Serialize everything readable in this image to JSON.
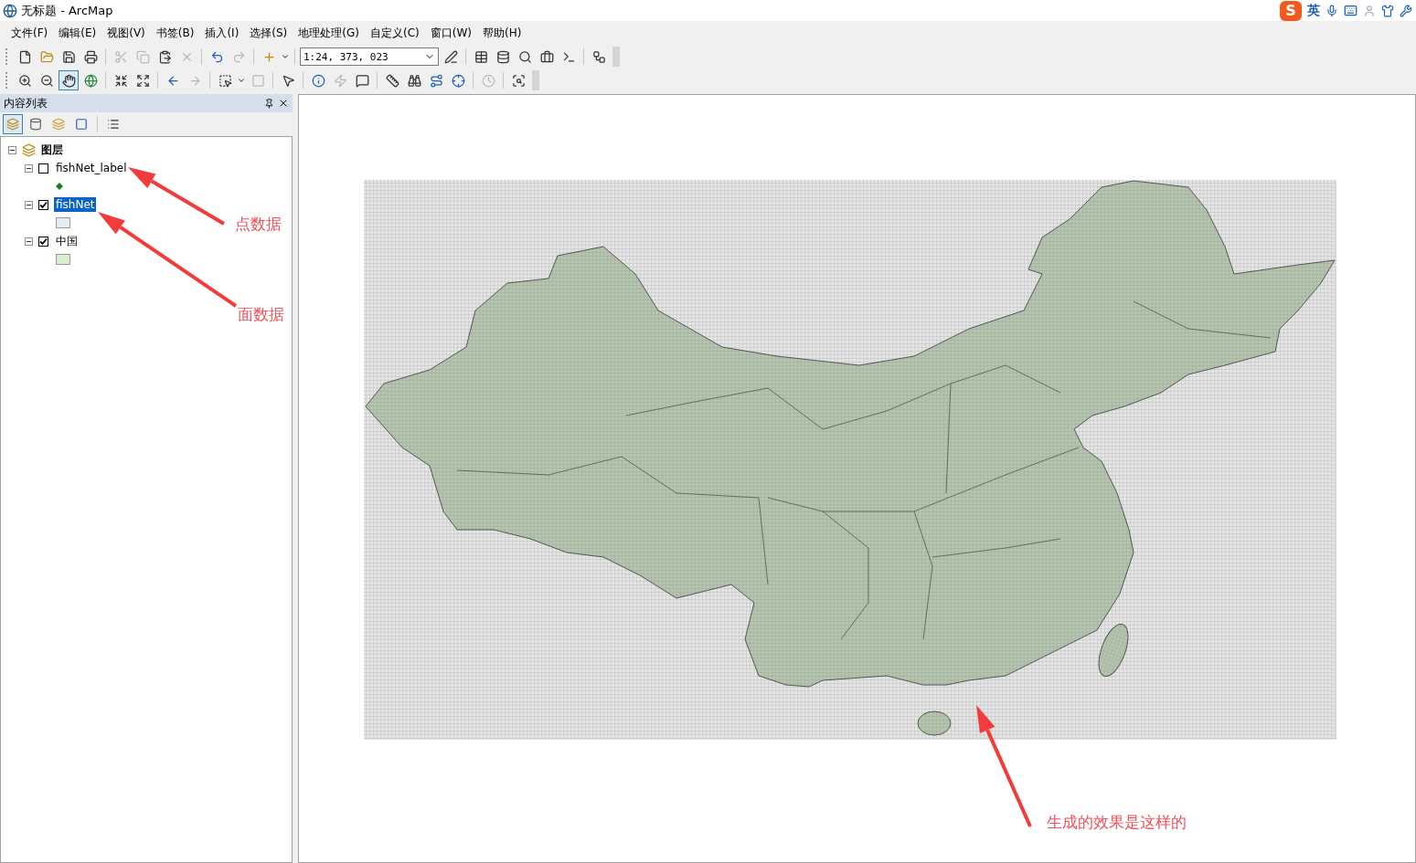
{
  "window": {
    "title": "无标题 - ArcMap"
  },
  "ime_bar": {
    "logo": "S",
    "mode": "英"
  },
  "menu": [
    "文件(F)",
    "编辑(E)",
    "视图(V)",
    "书签(B)",
    "插入(I)",
    "选择(S)",
    "地理处理(G)",
    "自定义(C)",
    "窗口(W)",
    "帮助(H)"
  ],
  "scale_field": {
    "value": "1:24, 373, 023"
  },
  "toc": {
    "title": "内容列表",
    "root": {
      "name": "图层",
      "expanded": true,
      "children": [
        {
          "name": "fishNet_label",
          "checked": false,
          "selected": false,
          "expanded": true,
          "symbol": {
            "kind": "point",
            "color": "#1e7a1e"
          }
        },
        {
          "name": "fishNet",
          "checked": true,
          "selected": true,
          "expanded": true,
          "symbol": {
            "kind": "polygon",
            "color": "#e3edf8"
          }
        },
        {
          "name": "中国",
          "checked": true,
          "selected": false,
          "expanded": true,
          "symbol": {
            "kind": "polygon",
            "color": "#d8f0cc"
          }
        }
      ]
    }
  },
  "annotations": [
    {
      "text": "点数据",
      "color": "#f2505a"
    },
    {
      "text": "面数据",
      "color": "#f2505a"
    },
    {
      "text": "生成的效果是这样的",
      "color": "#f2505a"
    }
  ]
}
